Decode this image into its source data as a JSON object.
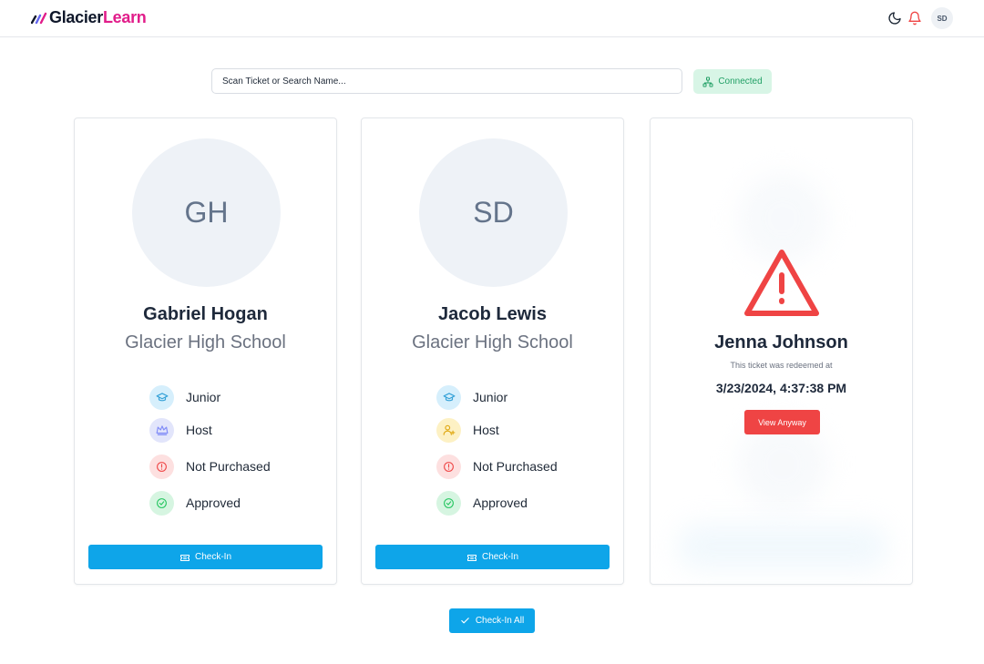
{
  "header": {
    "logo_part1": "Glacier",
    "logo_part2": "Learn",
    "user_initials": "SD",
    "icons": [
      "moon-icon",
      "bell-icon"
    ]
  },
  "search": {
    "placeholder": "Scan Ticket or Search Name..."
  },
  "status": {
    "label": "Connected",
    "color": "#22a066"
  },
  "cards": [
    {
      "initials": "GH",
      "name": "Gabriel Hogan",
      "school": "Glacier High School",
      "info": [
        {
          "label": "Junior",
          "icon": "graduation-cap-icon",
          "color": "#38bdf8"
        },
        {
          "label": "Host",
          "icon": "crown-icon",
          "color": "#818cf8"
        },
        {
          "label": "Not Purchased",
          "icon": "alert-circle-icon",
          "color": "#ef4444"
        },
        {
          "label": "Approved",
          "icon": "check-circle-icon",
          "color": "#22c55e"
        }
      ],
      "button": "Check-In"
    },
    {
      "initials": "SD",
      "name": "Jacob Lewis",
      "school": "Glacier High School",
      "info": [
        {
          "label": "Junior",
          "icon": "graduation-cap-icon",
          "color": "#38bdf8"
        },
        {
          "label": "Host",
          "icon": "user-plus-icon",
          "color": "#eab308"
        },
        {
          "label": "Not Purchased",
          "icon": "alert-circle-icon",
          "color": "#ef4444"
        },
        {
          "label": "Approved",
          "icon": "check-circle-icon",
          "color": "#22c55e"
        }
      ],
      "button": "Check-In"
    }
  ],
  "redeemed": {
    "name": "Jenna Johnson",
    "note": "This ticket was redeemed at",
    "date": "3/23/2024, 4:37:38 PM",
    "button": "View Anyway",
    "icon": "warning-triangle-icon"
  },
  "footer": {
    "button": "Check-In All"
  },
  "colors": {
    "primary": "#0ea5e9",
    "danger": "#ef4444",
    "brand": "#e11d8a"
  }
}
